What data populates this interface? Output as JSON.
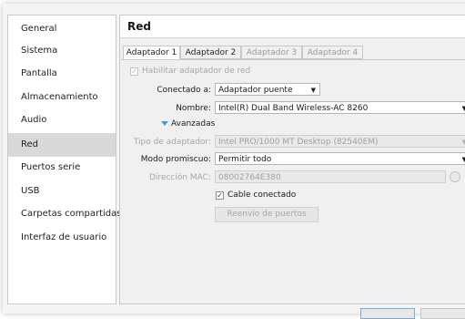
{
  "sidebar": {
    "items": [
      {
        "label": "General"
      },
      {
        "label": "Sistema"
      },
      {
        "label": "Pantalla"
      },
      {
        "label": "Almacenamiento"
      },
      {
        "label": "Audio"
      },
      {
        "label": "Red"
      },
      {
        "label": "Puertos serie"
      },
      {
        "label": "USB"
      },
      {
        "label": "Carpetas compartidas"
      },
      {
        "label": "Interfaz de usuario"
      }
    ],
    "selected": "Red"
  },
  "main": {
    "title": "Red",
    "tabs": [
      {
        "label": "Adaptador 1",
        "state": "active"
      },
      {
        "label": "Adaptador 2",
        "state": "enabled"
      },
      {
        "label": "Adaptador 3",
        "state": "disabled"
      },
      {
        "label": "Adaptador 4",
        "state": "disabled"
      }
    ]
  },
  "adapter": {
    "enable_label": "Habilitar adaptador de red",
    "enable_checked": true,
    "connected_label": "Conectado a:",
    "connected_value": "Adaptador puente",
    "name_label": "Nombre:",
    "name_value": "Intel(R) Dual Band Wireless-AC 8260",
    "advanced_label": "Avanzadas",
    "type_label": "Tipo de adaptador:",
    "type_value": "Intel PRO/1000 MT Desktop (82540EM)",
    "promisc_label": "Modo promiscuo:",
    "promisc_value": "Permitir todo",
    "mac_label": "Dirección MAC:",
    "mac_value": "08002764E380",
    "cable_label": "Cable conectado",
    "cable_checked": true,
    "port_forward_label": "Reenvío de puertos"
  },
  "icons": {
    "dropdown": "dropdown-arrow-icon",
    "expand": "expand-triangle-icon",
    "refresh_mac": "refresh-mac-icon",
    "check": "checkmark-icon"
  },
  "colors": {
    "sidebar_selected": "#d9d9d9",
    "accent": "#3d9be0"
  }
}
